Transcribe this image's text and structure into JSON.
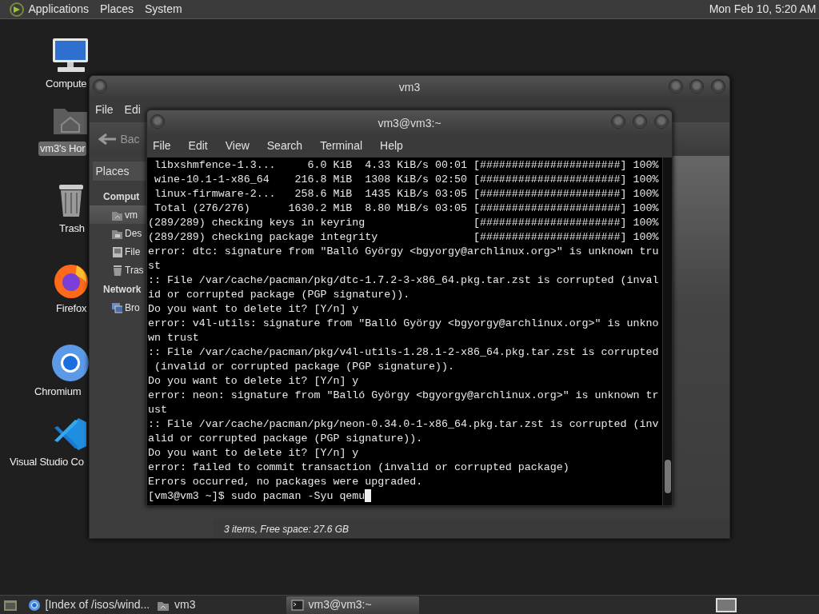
{
  "top_panel": {
    "menus": [
      "Applications",
      "Places",
      "System"
    ],
    "clock": "Mon Feb 10, 5:20 AM"
  },
  "desktop_icons": [
    {
      "label": "Compute",
      "kind": "computer",
      "selected": false
    },
    {
      "label": "vm3's Hor",
      "kind": "home",
      "selected": true
    },
    {
      "label": "Trash",
      "kind": "trash",
      "selected": false
    },
    {
      "label": "Firefox",
      "kind": "firefox",
      "selected": false
    },
    {
      "label": "Chromium",
      "kind": "chromium",
      "selected": false
    },
    {
      "label": "Visual Studio Co",
      "kind": "vscode",
      "selected": false
    }
  ],
  "file_manager": {
    "title": "vm3",
    "menu": [
      "File",
      "Edi"
    ],
    "back_label": "Bac",
    "places_dropdown": "Places",
    "sections": [
      {
        "heading": "Comput",
        "items": [
          {
            "label": "vm",
            "kind": "home",
            "selected": true
          },
          {
            "label": "Des",
            "kind": "desktop",
            "selected": false
          },
          {
            "label": "File",
            "kind": "drive",
            "selected": false
          },
          {
            "label": "Tras",
            "kind": "trash",
            "selected": false
          }
        ]
      },
      {
        "heading": "Network",
        "items": [
          {
            "label": "Bro",
            "kind": "network",
            "selected": false
          }
        ]
      }
    ],
    "status_bar": "3 items, Free space: 27.6 GB"
  },
  "terminal": {
    "title": "vm3@vm3:~",
    "menu": [
      "File",
      "Edit",
      "View",
      "Search",
      "Terminal",
      "Help"
    ],
    "lines": [
      " libxshmfence-1.3...     6.0 KiB  4.33 KiB/s 00:01 [######################] 100%",
      " wine-10.1-1-x86_64    216.8 MiB  1308 KiB/s 02:50 [######################] 100%",
      " linux-firmware-2...   258.6 MiB  1435 KiB/s 03:05 [######################] 100%",
      " Total (276/276)      1630.2 MiB  8.80 MiB/s 03:05 [######################] 100%",
      "(289/289) checking keys in keyring                 [######################] 100%",
      "(289/289) checking package integrity               [######################] 100%",
      "error: dtc: signature from \"Balló György <bgyorgy@archlinux.org>\" is unknown tru",
      "st",
      ":: File /var/cache/pacman/pkg/dtc-1.7.2-3-x86_64.pkg.tar.zst is corrupted (inval",
      "id or corrupted package (PGP signature)).",
      "Do you want to delete it? [Y/n] y",
      "error: v4l-utils: signature from \"Balló György <bgyorgy@archlinux.org>\" is unkno",
      "wn trust",
      ":: File /var/cache/pacman/pkg/v4l-utils-1.28.1-2-x86_64.pkg.tar.zst is corrupted",
      " (invalid or corrupted package (PGP signature)).",
      "Do you want to delete it? [Y/n] y",
      "error: neon: signature from \"Balló György <bgyorgy@archlinux.org>\" is unknown tr",
      "ust",
      ":: File /var/cache/pacman/pkg/neon-0.34.0-1-x86_64.pkg.tar.zst is corrupted (inv",
      "alid or corrupted package (PGP signature)).",
      "Do you want to delete it? [Y/n] y",
      "error: failed to commit transaction (invalid or corrupted package)",
      "Errors occurred, no packages were upgraded.",
      "[vm3@vm3 ~]$ sudo pacman -Syu qemu"
    ]
  },
  "taskbar": {
    "tasks": [
      {
        "label": "[Index of /isos/wind...",
        "kind": "browser",
        "selected": false
      },
      {
        "label": "vm3",
        "kind": "home",
        "selected": false
      },
      {
        "label": "vm3@vm3:~",
        "kind": "terminal",
        "selected": true
      }
    ]
  }
}
